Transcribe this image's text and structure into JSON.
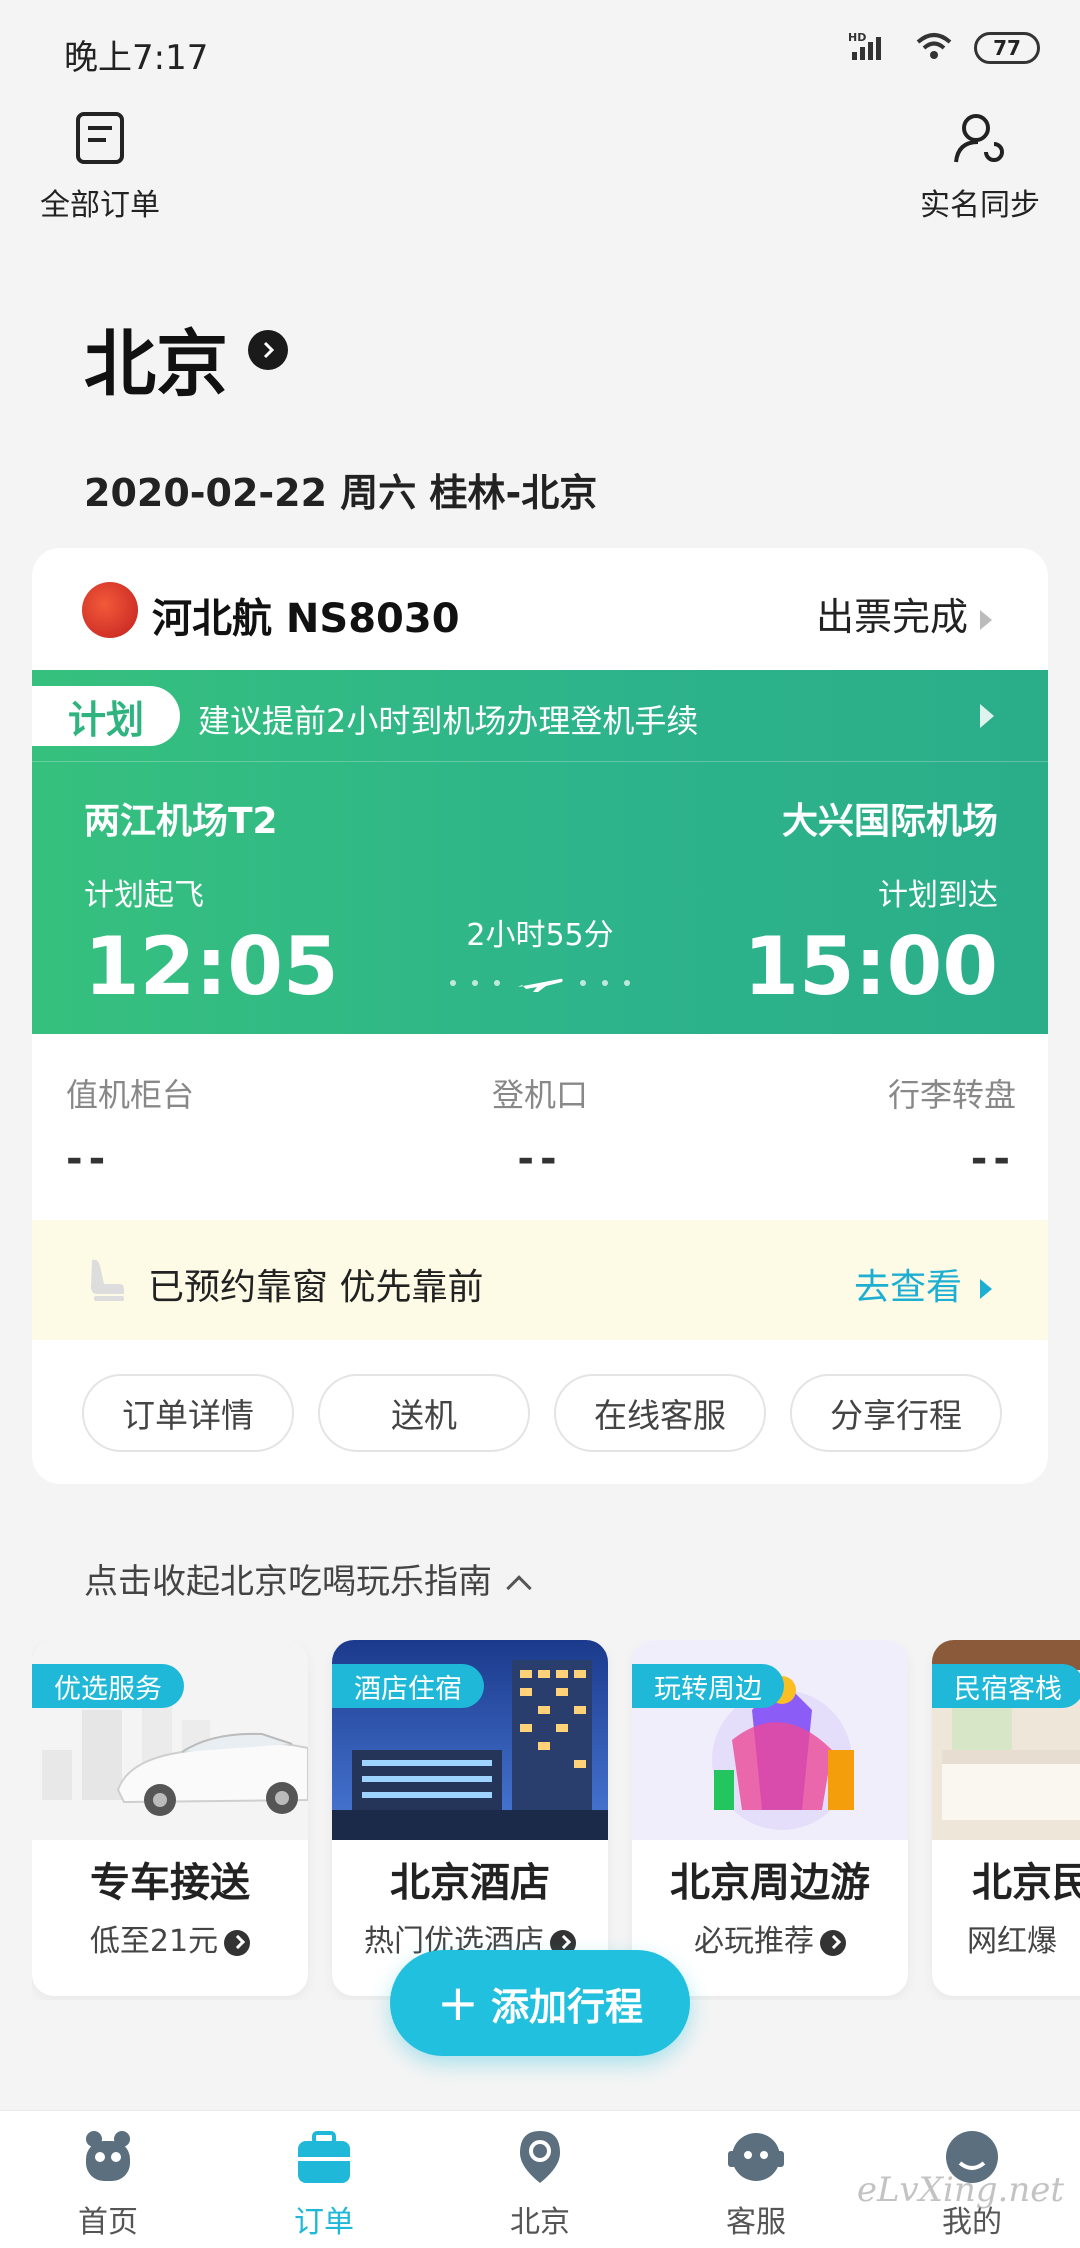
{
  "status_bar": {
    "time": "晚上7:17",
    "battery": "77",
    "network": "HD"
  },
  "top": {
    "orders_label": "全部订单",
    "realname_label": "实名同步"
  },
  "city": {
    "name": "北京"
  },
  "trip": {
    "summary": "2020-02-22 周六   桂林-北京"
  },
  "flight": {
    "airline": "河北航 NS8030",
    "status": "出票完成",
    "plan_tag": "计划",
    "plan_note": "建议提前2小时到机场办理登机手续",
    "departure_airport": "两江机场T2",
    "arrival_airport": "大兴国际机场",
    "departure_label": "计划起飞",
    "arrival_label": "计划到达",
    "departure_time": "12:05",
    "arrival_time": "15:00",
    "duration": "2小时55分",
    "gates": {
      "checkin_label": "值机柜台",
      "checkin_value": "--",
      "gate_label": "登机口",
      "gate_value": "--",
      "baggage_label": "行李转盘",
      "baggage_value": "--"
    },
    "seat_text": "已预约靠窗 优先靠前",
    "seat_link": "去查看",
    "actions": [
      "订单详情",
      "送机",
      "在线客服",
      "分享行程"
    ]
  },
  "guide": {
    "toggle": "点击收起北京吃喝玩乐指南",
    "tiles": [
      {
        "tag": "优选服务",
        "title": "专车接送",
        "sub": "低至21元"
      },
      {
        "tag": "酒店住宿",
        "title": "北京酒店",
        "sub": "热门优选酒店"
      },
      {
        "tag": "玩转周边",
        "title": "北京周边游",
        "sub": "必玩推荐"
      },
      {
        "tag": "民宿客栈",
        "title": "北京民",
        "sub": "网红爆"
      }
    ]
  },
  "fab": {
    "label": "添加行程"
  },
  "nav": [
    "首页",
    "订单",
    "北京",
    "客服",
    "我的"
  ],
  "watermark": "eLvXing.net",
  "colors": {
    "accent": "#1fb8d8",
    "flight_green": "#2fb47f"
  }
}
